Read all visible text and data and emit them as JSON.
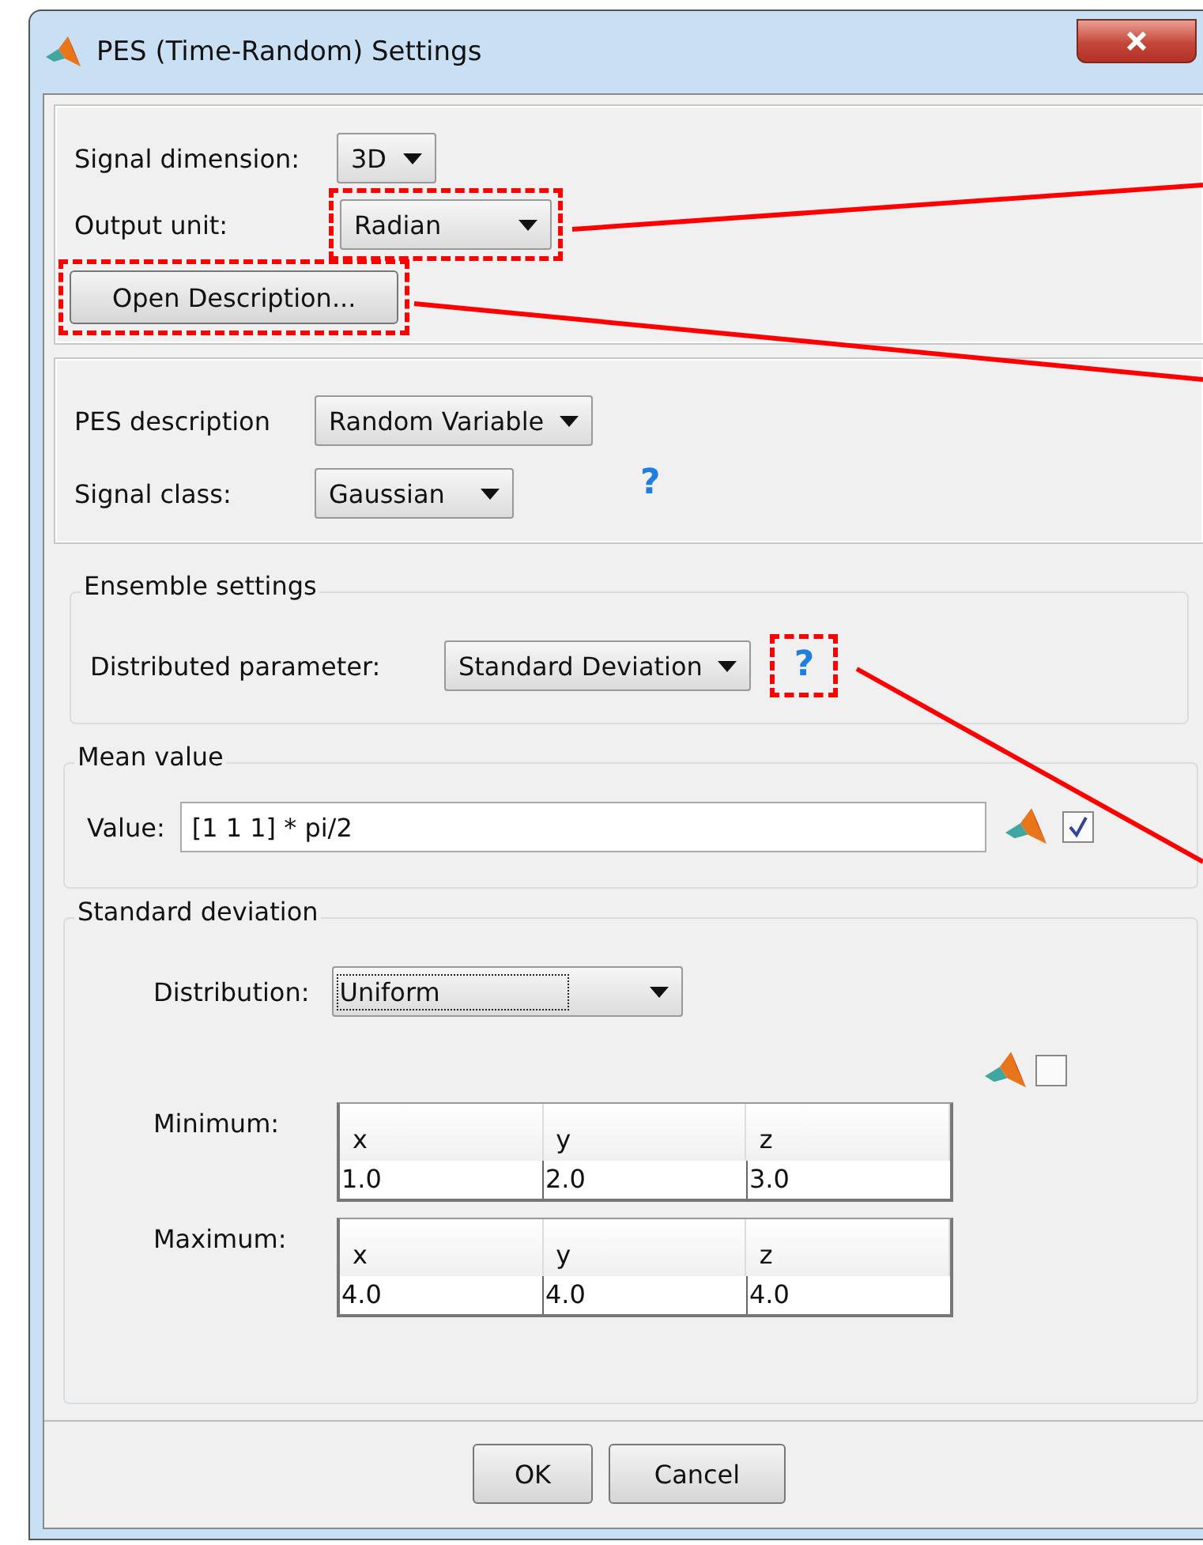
{
  "window": {
    "title": "PES (Time-Random) Settings"
  },
  "general": {
    "signal_dimension": {
      "label": "Signal dimension:",
      "value": "3D"
    },
    "output_unit": {
      "label": "Output unit:",
      "value": "Radian",
      "highlighted": true
    },
    "open_description": {
      "label": "Open Description...",
      "highlighted": true
    }
  },
  "pes": {
    "description": {
      "label": "PES description",
      "value": "Random Variable"
    },
    "signal_class": {
      "label": "Signal class:",
      "value": "Gaussian"
    },
    "help": "?"
  },
  "ensemble": {
    "title": "Ensemble settings",
    "parameter": {
      "label": "Distributed parameter:",
      "value": "Standard Deviation"
    },
    "help": {
      "text": "?",
      "highlighted": true
    }
  },
  "mean": {
    "title": "Mean value",
    "label": "Value:",
    "value": "[1 1 1] * pi/2",
    "checked": true
  },
  "std": {
    "title": "Standard deviation",
    "distribution": {
      "label": "Distribution:",
      "value": "Uniform",
      "focused": true
    },
    "checked": false,
    "tables": [
      {
        "label": "Minimum:",
        "columns": [
          "x",
          "y",
          "z"
        ],
        "values": [
          "1.0",
          "2.0",
          "3.0"
        ]
      },
      {
        "label": "Maximum:",
        "columns": [
          "x",
          "y",
          "z"
        ],
        "values": [
          "4.0",
          "4.0",
          "4.0"
        ]
      }
    ]
  },
  "buttons": [
    "OK",
    "Cancel"
  ]
}
